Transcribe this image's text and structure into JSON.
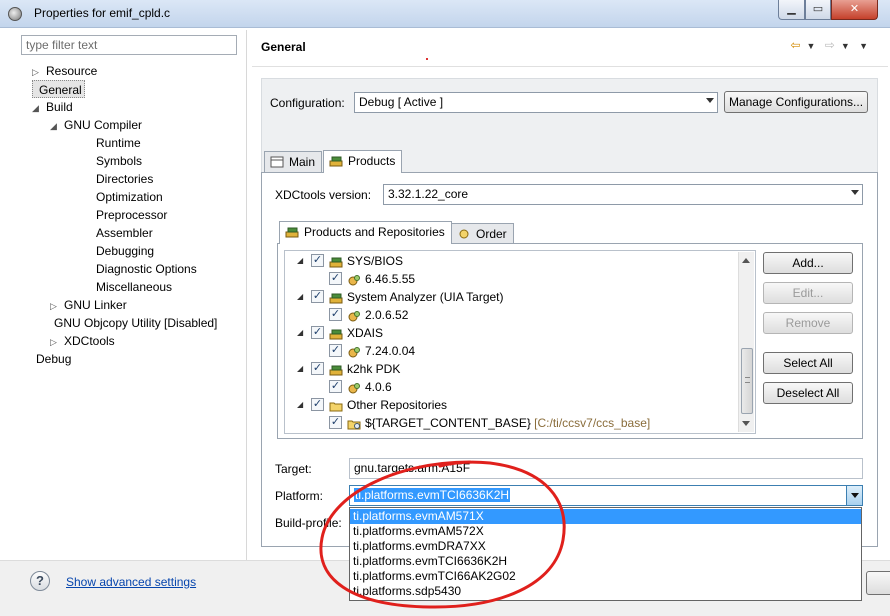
{
  "window": {
    "title": "Properties for emif_cpld.c"
  },
  "left": {
    "filter_placeholder": "type filter text",
    "tree": [
      {
        "label": "Resource",
        "twisty": "▷",
        "depth": 0
      },
      {
        "label": "General",
        "twisty": "",
        "depth": 0,
        "selected": true
      },
      {
        "label": "Build",
        "twisty": "◢",
        "depth": 0
      },
      {
        "label": "GNU Compiler",
        "twisty": "◢",
        "depth": 1
      },
      {
        "label": "Runtime",
        "twisty": "",
        "depth": 2
      },
      {
        "label": "Symbols",
        "twisty": "",
        "depth": 2
      },
      {
        "label": "Directories",
        "twisty": "",
        "depth": 2
      },
      {
        "label": "Optimization",
        "twisty": "",
        "depth": 2
      },
      {
        "label": "Preprocessor",
        "twisty": "",
        "depth": 2
      },
      {
        "label": "Assembler",
        "twisty": "",
        "depth": 2
      },
      {
        "label": "Debugging",
        "twisty": "",
        "depth": 2
      },
      {
        "label": "Diagnostic Options",
        "twisty": "",
        "depth": 2
      },
      {
        "label": "Miscellaneous",
        "twisty": "",
        "depth": 2
      },
      {
        "label": "GNU Linker",
        "twisty": "▷",
        "depth": 1
      },
      {
        "label": "GNU Objcopy Utility  [Disabled]",
        "twisty": "",
        "depth": 1
      },
      {
        "label": "XDCtools",
        "twisty": "▷",
        "depth": 1
      },
      {
        "label": "Debug",
        "twisty": "",
        "depth": 0
      }
    ]
  },
  "page": {
    "title": "General",
    "configuration_label": "Configuration:",
    "configuration_value": "Debug  [ Active ]",
    "manage_button": "Manage Configurations...",
    "tabs": {
      "main": "Main",
      "products": "Products"
    },
    "xdc_label": "XDCtools version:",
    "xdc_value": "3.32.1.22_core",
    "subtabs": {
      "products_repos": "Products and Repositories",
      "order": "Order"
    },
    "products": [
      {
        "name": "SYS/BIOS",
        "version": "6.46.5.55"
      },
      {
        "name": "System Analyzer (UIA Target)",
        "version": "2.0.6.52"
      },
      {
        "name": "XDAIS",
        "version": "7.24.0.04"
      },
      {
        "name": "k2hk PDK",
        "version": "4.0.6"
      },
      {
        "name": "Other Repositories",
        "version": "${TARGET_CONTENT_BASE}",
        "path": "[C:/ti/ccsv7/ccs_base]"
      }
    ],
    "buttons": {
      "add": "Add...",
      "edit": "Edit...",
      "remove": "Remove",
      "select_all": "Select All",
      "deselect_all": "Deselect All"
    },
    "target_label": "Target:",
    "target_value": "gnu.targets.arm.A15F",
    "platform_label": "Platform:",
    "platform_value": "ti.platforms.evmTCI6636K2H",
    "build_profile_label": "Build-profile:",
    "platform_options": [
      "ti.platforms.evmAM571X",
      "ti.platforms.evmAM572X",
      "ti.platforms.evmDRA7XX",
      "ti.platforms.evmTCI6636K2H",
      "ti.platforms.evmTCI66AK2G02",
      "ti.platforms.sdp5430"
    ]
  },
  "bottom": {
    "help": "?",
    "advanced_link": "Show advanced settings"
  }
}
